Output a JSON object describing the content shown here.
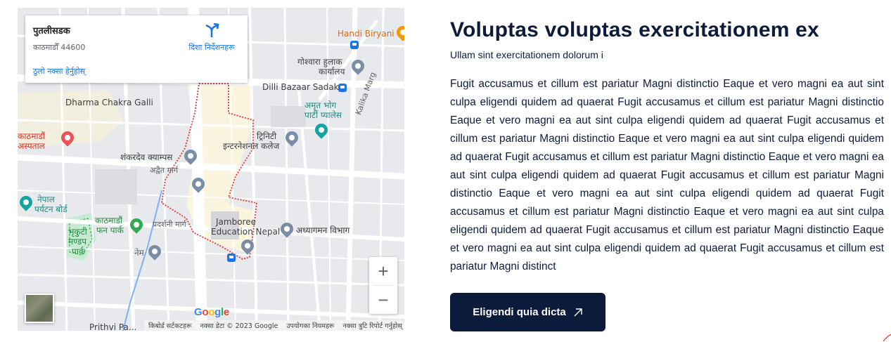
{
  "map": {
    "place_card": {
      "title": "पुतलीसडक",
      "address": "काठमाडौँ 44600",
      "directions_label": "दिशा निर्देशनहरू",
      "larger_map_link": "ठुलो नक्सा हेर्नुहोस्"
    },
    "labels": {
      "handi_biryani": "Handi Biryani",
      "goshwara_1": "गोश्वारा हुलाक",
      "goshwara_2": "कार्यालय",
      "dilli_bazaar": "Dilli Bazaar Sadak",
      "dharma_chakra": "Dharma Chakra Galli",
      "amrit_bhog_1": "अमृत भोग",
      "amrit_bhog_2": "पार्टी प्यालेस",
      "kalika_marg": "Kalika Marg",
      "kathmandu_hosp_1": "काठमाडौं",
      "kathmandu_hosp_2": "अस्पताल",
      "trinity_1": "ट्रिनिटी",
      "trinity_2": "इन्टरनेशनल कलेज",
      "shankardev": "शंकरदेव क्याम्पस",
      "adwait_marg": "अद्वैत मार्ग",
      "nepal_tourism_1": "नेपाल",
      "nepal_tourism_2": "पर्यटन बोर्ड",
      "fun_park_1": "काठमाडौं",
      "fun_park_2": "फन पार्क",
      "bhrikuti_1": "भृकुटी",
      "bhrikuti_2": "मण्डप",
      "bhrikuti_3": "पार्क",
      "pradarshani": "प्रदर्शनी मार्ग",
      "jamboree_1": "Jamboree",
      "jamboree_2": "Education Nepal",
      "adhyagaman": "अध्यागमन विभाग",
      "nem": "नेम",
      "prithvi": "Prithvi Pa..."
    },
    "zoom_in": "+",
    "zoom_out": "−",
    "google_letters": [
      "G",
      "o",
      "o",
      "g",
      "l",
      "e"
    ],
    "google_colors": [
      "#4285F4",
      "#EA4335",
      "#FBBC05",
      "#4285F4",
      "#34A853",
      "#EA4335"
    ],
    "footer": {
      "shortcuts": "किबोर्ड सर्टकटहरू",
      "map_data": "नक्सा डेटा © 2023 Google",
      "terms": "उपयोगका नियमहरू",
      "report": "नक्सा त्रुटि रिपोर्ट गर्नुहोस्"
    }
  },
  "content": {
    "heading": "Voluptas voluptas exercitationem ex",
    "subheading": "Ullam sint exercitationem dolorum i",
    "body": "Fugit accusamus et cillum est pariatur Magni distinctio Eaque et vero magni ea aut sint culpa eligendi quidem ad quaerat Fugit accusamus et cillum est pariatur Magni distinctio Eaque et vero magni ea aut sint culpa eligendi quidem ad quaerat Fugit accusamus et cillum est pariatur Magni distinctio Eaque et vero magni ea aut sint culpa eligendi quidem ad quaerat Fugit accusamus et cillum est pariatur Magni distinctio Eaque et vero magni ea aut sint culpa eligendi quidem ad quaerat Fugit accusamus et cillum est pariatur Magni distinctio Eaque et vero magni ea aut sint culpa eligendi quidem ad quaerat Fugit accusamus et cillum est pariatur Magni distinctio Eaque et vero magni ea aut sint culpa eligendi quidem ad quaerat Fugit accusamus et cillum est pariatur Magni distinctio Eaque et vero magni ea aut sint culpa eligendi quidem ad quaerat Fugit accusamus et cillum est pariatur Magni distinct",
    "cta_label": "Eligendi quia dicta",
    "cta_icon": "arrow-up-right-icon"
  },
  "colors": {
    "navy": "#0c1a3c",
    "link_blue": "#1a73e8",
    "boundary_red": "#e53935"
  }
}
